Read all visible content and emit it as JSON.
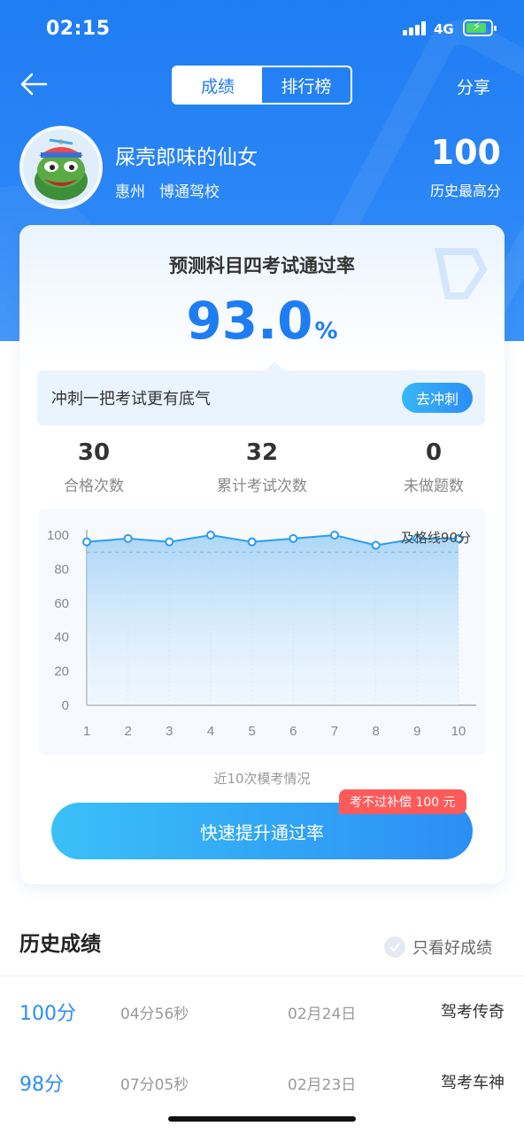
{
  "status_bar": {
    "time": "02:15",
    "network": "4G"
  },
  "header": {
    "tabs": [
      {
        "label": "成绩",
        "active": true
      },
      {
        "label": "排行榜",
        "active": false
      }
    ],
    "share_label": "分享"
  },
  "profile": {
    "name": "屎壳郎味的仙女",
    "city": "惠州",
    "school": "博通驾校",
    "best_score": "100",
    "best_label": "历史最高分"
  },
  "card": {
    "title": "预测科目四考试通过率",
    "rate_value": "93.0",
    "rate_unit": "%",
    "tip_text": "冲刺一把考试更有底气",
    "tip_button": "去冲刺",
    "stats": [
      {
        "value": "30",
        "label": "合格次数"
      },
      {
        "value": "32",
        "label": "累计考试次数"
      },
      {
        "value": "0",
        "label": "未做题数"
      }
    ],
    "chart_caption": "近10次模考情况",
    "cta_label": "快速提升通过率",
    "badge_label": "考不过补偿 100 元"
  },
  "chart_data": {
    "type": "area",
    "x": [
      1,
      2,
      3,
      4,
      5,
      6,
      7,
      8,
      9,
      10
    ],
    "values": [
      96,
      98,
      96,
      100,
      96,
      98,
      100,
      94,
      98,
      98
    ],
    "ylim": [
      0,
      100
    ],
    "yticks": [
      0,
      20,
      40,
      60,
      80,
      100
    ],
    "reference_line": {
      "value": 90,
      "label": "及格线90分"
    },
    "color": "#2b9cf0"
  },
  "history": {
    "title": "历史成绩",
    "filter_label": "只看好成绩",
    "rows": [
      {
        "score": "100分",
        "duration": "04分56秒",
        "date": "02月24日",
        "title": "驾考传奇"
      },
      {
        "score": "98分",
        "duration": "07分05秒",
        "date": "02月23日",
        "title": "驾考车神"
      }
    ]
  }
}
